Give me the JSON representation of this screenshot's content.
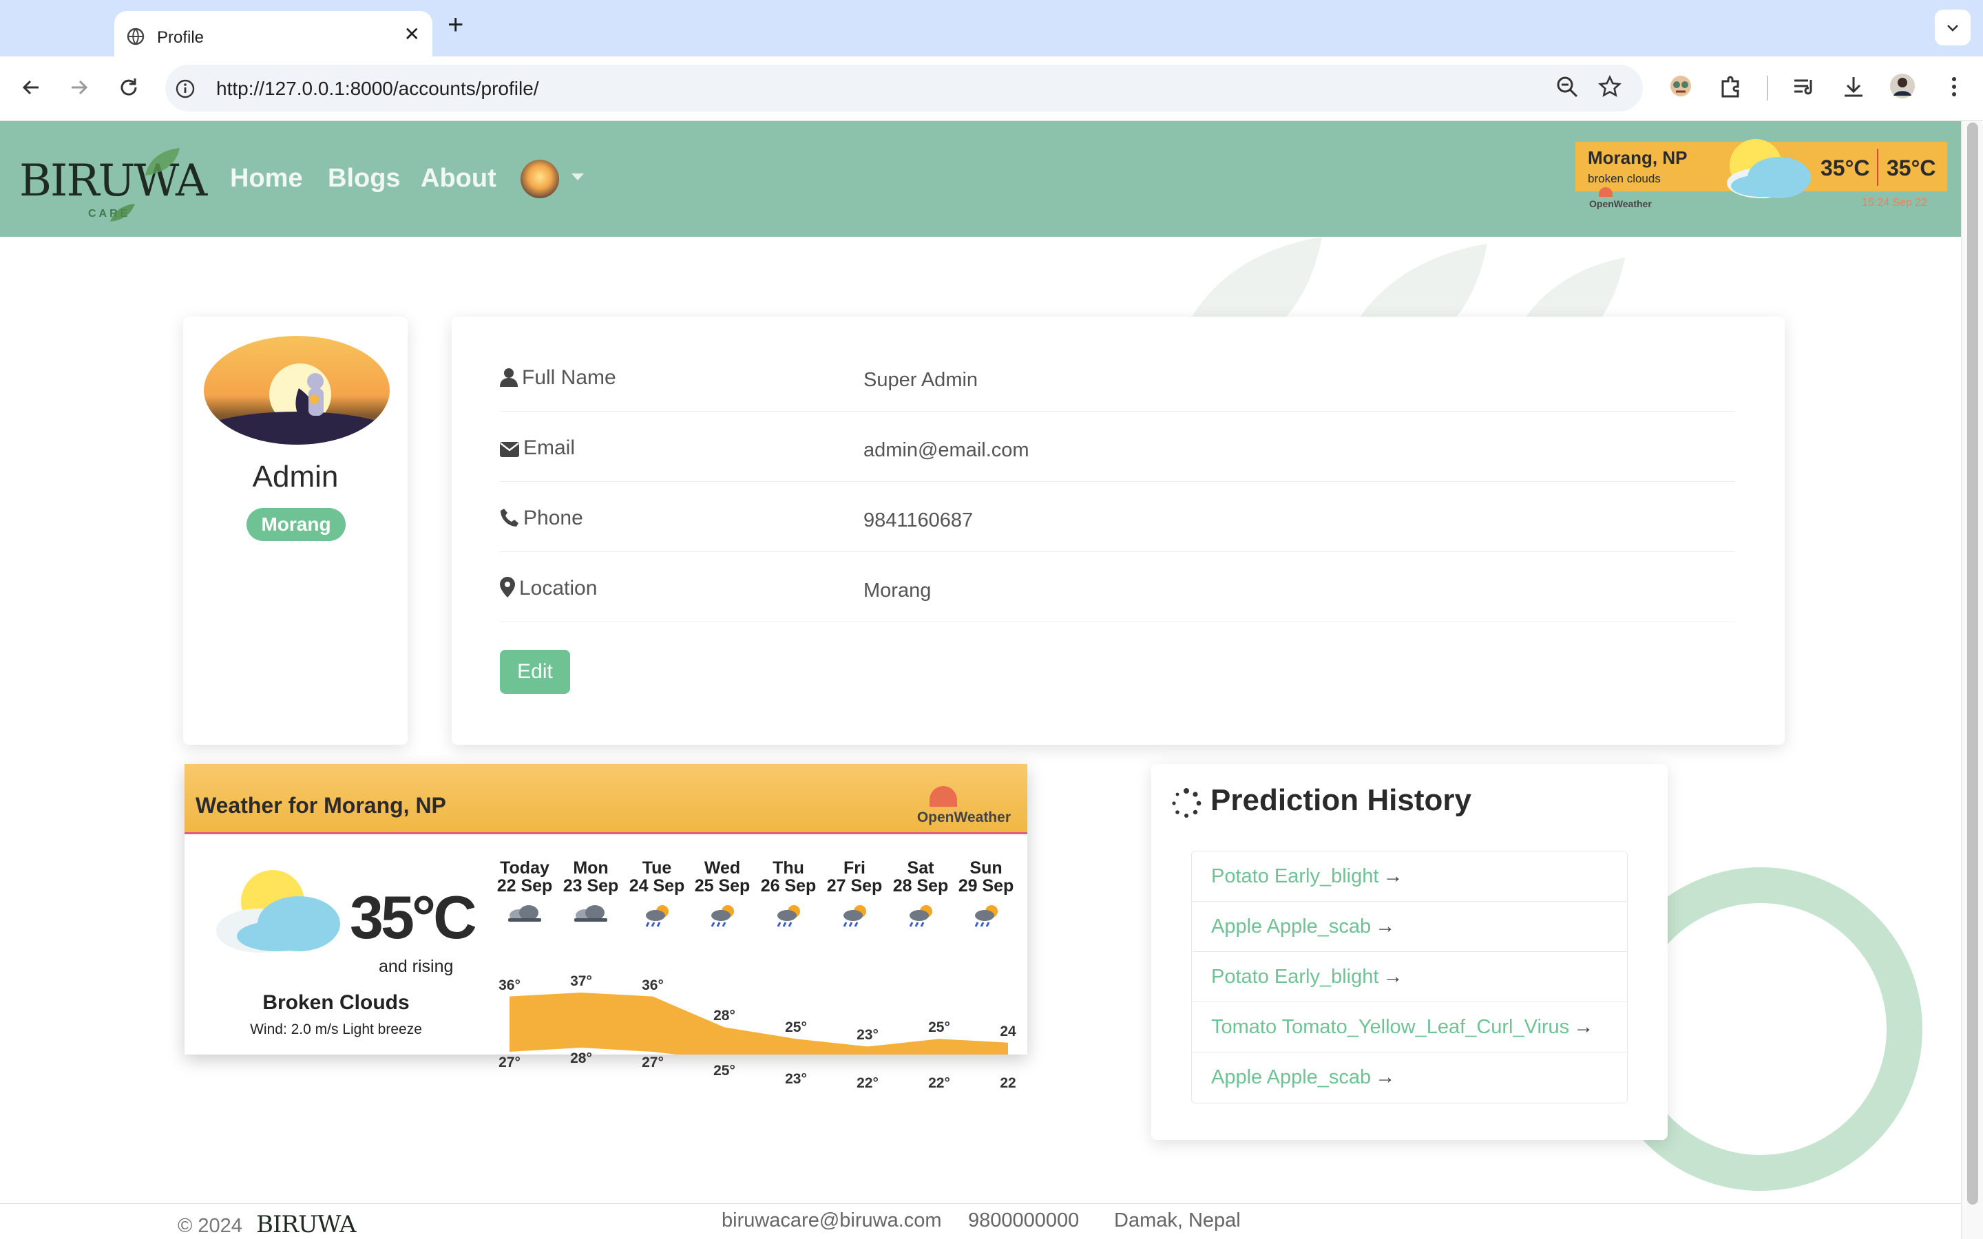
{
  "browser": {
    "tab_title": "Profile",
    "url": "http://127.0.0.1:8000/accounts/profile/"
  },
  "site": {
    "logo": "BIRUWA",
    "logo_sub": "CARE",
    "nav": [
      "Home",
      "Blogs",
      "About"
    ]
  },
  "header_weather": {
    "location": "Morang, NP",
    "description": "broken clouds",
    "temp1": "35°C",
    "temp2": "35°C",
    "brand": "OpenWeather",
    "time": "15:24 Sep 22"
  },
  "profile": {
    "name": "Admin",
    "location_badge": "Morang"
  },
  "info": {
    "full_name_label": "Full Name",
    "full_name": "Super Admin",
    "email_label": "Email",
    "email": "admin@email.com",
    "phone_label": "Phone",
    "phone": "9841160687",
    "location_label": "Location",
    "location": "Morang",
    "edit": "Edit"
  },
  "forecast": {
    "title": "Weather for Morang, NP",
    "brand": "OpenWeather",
    "temp": "35°C",
    "trend": "and rising",
    "condition": "Broken Clouds",
    "wind": "Wind: 2.0 m/s Light breeze",
    "days": [
      {
        "day": "Today",
        "date": "22 Sep",
        "hi": "36°",
        "lo": "27°",
        "icon": "cloud-icon"
      },
      {
        "day": "Mon",
        "date": "23 Sep",
        "hi": "37°",
        "lo": "28°",
        "icon": "cloud-icon"
      },
      {
        "day": "Tue",
        "date": "24 Sep",
        "hi": "36°",
        "lo": "27°",
        "icon": "rain-sun-icon"
      },
      {
        "day": "Wed",
        "date": "25 Sep",
        "hi": "28°",
        "lo": "25°",
        "icon": "rain-sun-icon"
      },
      {
        "day": "Thu",
        "date": "26 Sep",
        "hi": "25°",
        "lo": "23°",
        "icon": "rain-sun-icon"
      },
      {
        "day": "Fri",
        "date": "27 Sep",
        "hi": "23°",
        "lo": "22°",
        "icon": "rain-sun-icon"
      },
      {
        "day": "Sat",
        "date": "28 Sep",
        "hi": "25°",
        "lo": "22°",
        "icon": "rain-sun-icon"
      },
      {
        "day": "Sun",
        "date": "29 Sep",
        "hi": "24",
        "lo": "22",
        "icon": "rain-sun-icon"
      }
    ],
    "hi_values": [
      36,
      37,
      36,
      28,
      25,
      23,
      25,
      24
    ],
    "lo_values": [
      27,
      28,
      27,
      25,
      23,
      22,
      22,
      22
    ]
  },
  "predictions": {
    "title": "Prediction History",
    "items": [
      "Potato Early_blight",
      "Apple Apple_scab",
      "Potato Early_blight",
      "Tomato Tomato_Yellow_Leaf_Curl_Virus",
      "Apple Apple_scab"
    ]
  },
  "footer": {
    "copyright": "© 2024",
    "logo": "BIRUWA",
    "email": "biruwacare@biruwa.com",
    "phone": "9800000000",
    "address": "Damak, Nepal"
  },
  "colors": {
    "header": "#8cc2ac",
    "accent": "#6fc294",
    "weather": "#f4b845"
  }
}
